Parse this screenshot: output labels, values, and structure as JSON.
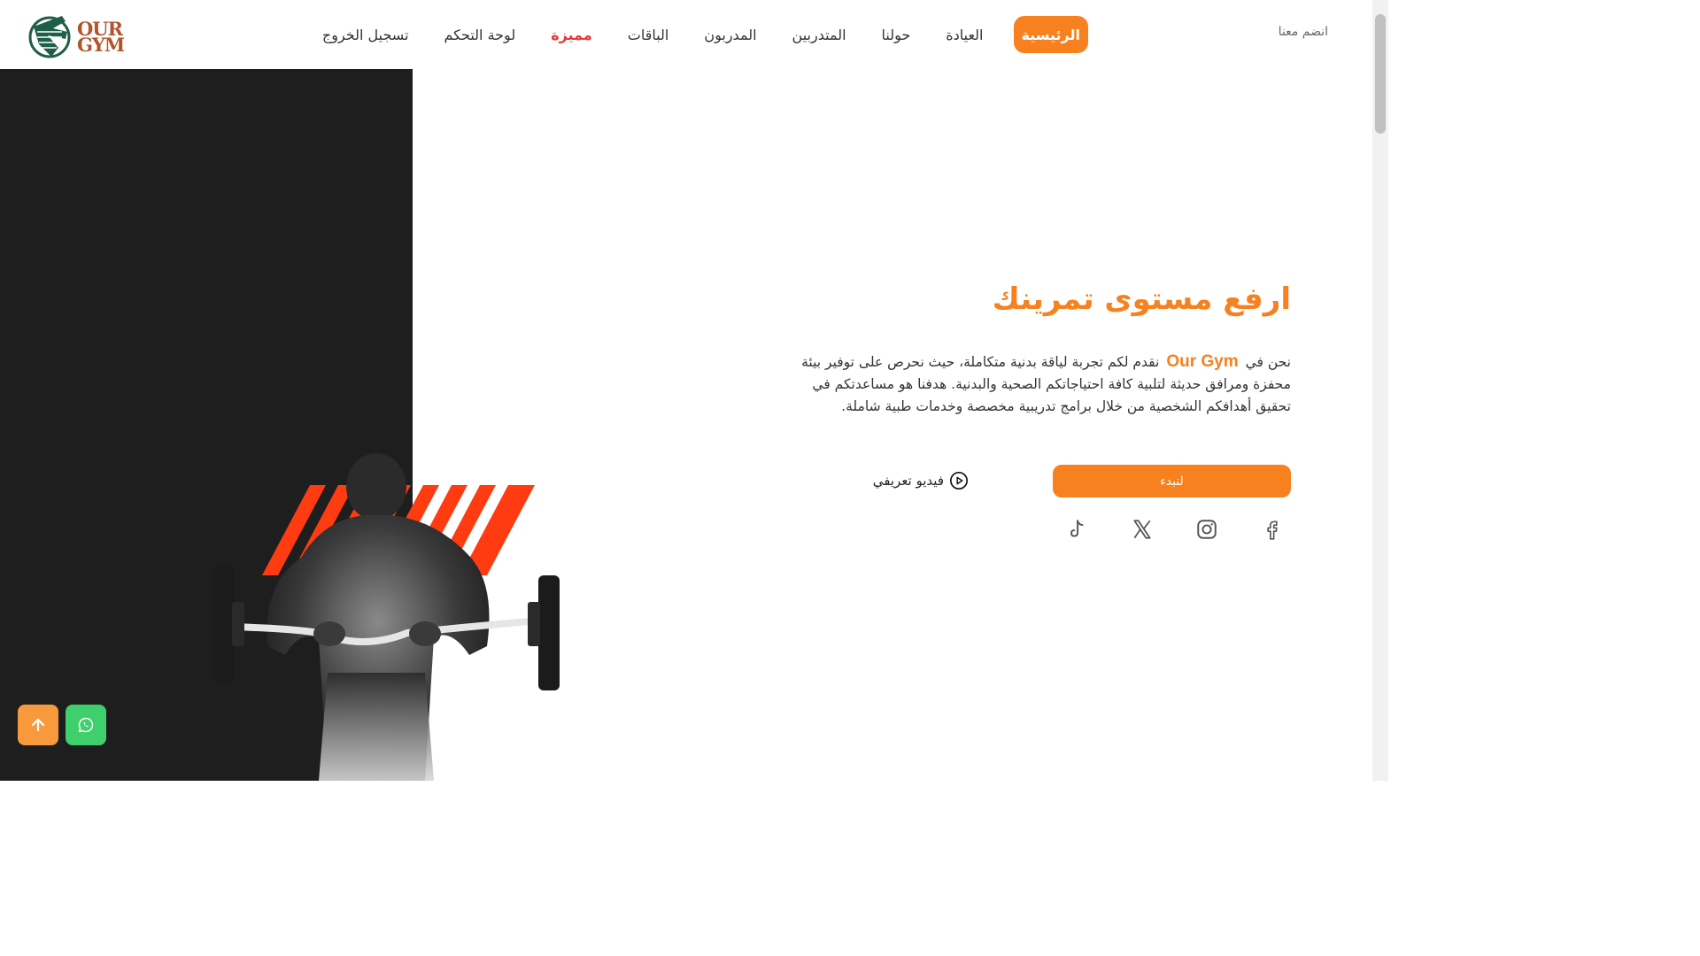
{
  "logo": {
    "line1": "OUR",
    "line2": "GYM"
  },
  "nav": {
    "items": [
      {
        "label": "الرئيسية",
        "state": "active"
      },
      {
        "label": "العيادة",
        "state": ""
      },
      {
        "label": "حولنا",
        "state": ""
      },
      {
        "label": "المتدربين",
        "state": ""
      },
      {
        "label": "المدربون",
        "state": ""
      },
      {
        "label": "الباقات",
        "state": ""
      },
      {
        "label": "مميزة",
        "state": "featured"
      },
      {
        "label": "لوحة التحكم",
        "state": ""
      },
      {
        "label": "تسجيل الخروج",
        "state": ""
      }
    ],
    "join_label": "انضم معنا"
  },
  "hero": {
    "title": "ارفع مستوى تمرينك",
    "desc_prefix": "نحن في",
    "brand": "Our Gym",
    "desc_rest": "نقدم لكم تجربة لياقة بدنية متكاملة، حيث نحرص على توفير بيئة محفزة ومرافق حديثة لتلبية كافة احتياجاتكم الصحية والبدنية. هدفنا هو مساعدتكم في تحقيق أهدافكم الشخصية من خلال برامج تدريبية مخصصة وخدمات طبية شاملة.",
    "start_label": "لنبدء",
    "video_label": "فيديو تعريفي"
  },
  "socials": [
    "facebook-icon",
    "instagram-icon",
    "x-icon",
    "tiktok-icon"
  ],
  "colors": {
    "accent": "#f7811e",
    "featured": "#e53935",
    "dark_panel": "#1e1e1f",
    "whatsapp": "#3fcf6c"
  }
}
